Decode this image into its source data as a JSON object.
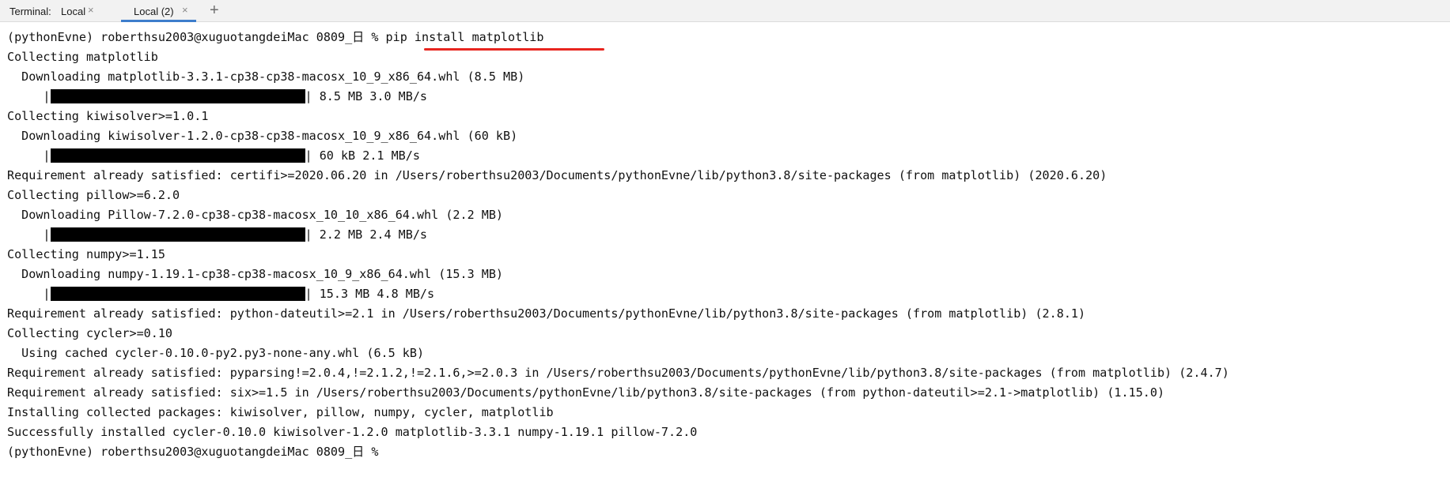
{
  "tabbar": {
    "title": "Terminal:",
    "tabs": [
      {
        "label": "Local",
        "close": "×",
        "active": false
      },
      {
        "label": "Local (2)",
        "close": "×",
        "active": true
      }
    ],
    "add_icon": "+"
  },
  "accent_colors": {
    "active_tab_underline": "#3d7dcc",
    "annotation_underline": "#e8251f"
  },
  "terminal": {
    "lines": [
      "(pythonEvne) roberthsu2003@xuguotangdeiMac 0809_日 % pip install matplotlib",
      "Collecting matplotlib",
      "  Downloading matplotlib-3.3.1-cp38-cp38-macosx_10_9_x86_64.whl (8.5 MB)",
      "     |",
      "| 8.5 MB 3.0 MB/s",
      "Collecting kiwisolver>=1.0.1",
      "  Downloading kiwisolver-1.2.0-cp38-cp38-macosx_10_9_x86_64.whl (60 kB)",
      "     |",
      "| 60 kB 2.1 MB/s",
      "Requirement already satisfied: certifi>=2020.06.20 in /Users/roberthsu2003/Documents/pythonEvne/lib/python3.8/site-packages (from matplotlib) (2020.6.20)",
      "Collecting pillow>=6.2.0",
      "  Downloading Pillow-7.2.0-cp38-cp38-macosx_10_10_x86_64.whl (2.2 MB)",
      "     |",
      "| 2.2 MB 2.4 MB/s",
      "Collecting numpy>=1.15",
      "  Downloading numpy-1.19.1-cp38-cp38-macosx_10_9_x86_64.whl (15.3 MB)",
      "     |",
      "| 15.3 MB 4.8 MB/s",
      "Requirement already satisfied: python-dateutil>=2.1 in /Users/roberthsu2003/Documents/pythonEvne/lib/python3.8/site-packages (from matplotlib) (2.8.1)",
      "Collecting cycler>=0.10",
      "  Using cached cycler-0.10.0-py2.py3-none-any.whl (6.5 kB)",
      "Requirement already satisfied: pyparsing!=2.0.4,!=2.1.2,!=2.1.6,>=2.0.3 in /Users/roberthsu2003/Documents/pythonEvne/lib/python3.8/site-packages (from matplotlib) (2.4.7)",
      "Requirement already satisfied: six>=1.5 in /Users/roberthsu2003/Documents/pythonEvne/lib/python3.8/site-packages (from python-dateutil>=2.1->matplotlib) (1.15.0)",
      "Installing collected packages: kiwisolver, pillow, numpy, cycler, matplotlib",
      "Successfully installed cycler-0.10.0 kiwisolver-1.2.0 matplotlib-3.3.1 numpy-1.19.1 pillow-7.2.0",
      "(pythonEvne) roberthsu2003@xuguotangdeiMac 0809_日 % "
    ],
    "progress_values": [
      1.0,
      1.0,
      1.0,
      1.0
    ]
  }
}
